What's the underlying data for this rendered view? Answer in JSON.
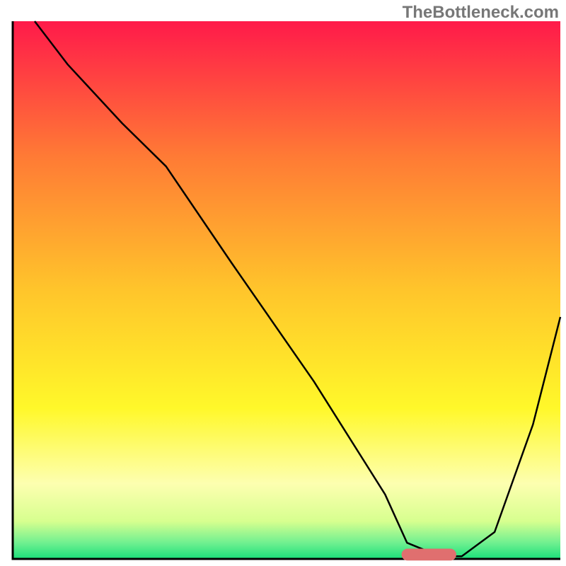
{
  "watermark": "TheBottleneck.com",
  "chart_data": {
    "type": "line",
    "title": "",
    "xlabel": "",
    "ylabel": "",
    "xlim": [
      0,
      100
    ],
    "ylim": [
      0,
      100
    ],
    "background": {
      "type": "vertical-gradient",
      "stops": [
        {
          "pos": 0.0,
          "color": "#ff1a4a"
        },
        {
          "pos": 0.25,
          "color": "#ff7a35"
        },
        {
          "pos": 0.5,
          "color": "#ffc52b"
        },
        {
          "pos": 0.72,
          "color": "#fff82a"
        },
        {
          "pos": 0.86,
          "color": "#fdffb0"
        },
        {
          "pos": 0.93,
          "color": "#d7ff8f"
        },
        {
          "pos": 0.97,
          "color": "#70f090"
        },
        {
          "pos": 1.0,
          "color": "#1adf7a"
        }
      ]
    },
    "series": [
      {
        "name": "bottleneck-curve",
        "color": "#000000",
        "stroke_width": 2.5,
        "x": [
          4,
          10,
          20,
          28,
          40,
          55,
          68,
          72,
          78,
          82,
          88,
          95,
          100
        ],
        "y": [
          100,
          92,
          81,
          73,
          55,
          33,
          12,
          3,
          0.5,
          0.5,
          5,
          25,
          45
        ]
      }
    ],
    "marker": {
      "name": "optimal-zone",
      "shape": "rounded-bar",
      "color": "#e06f6f",
      "x_center": 76,
      "y": 0.8,
      "width": 10,
      "height": 2.2
    },
    "axes": {
      "show_ticks": false,
      "show_grid": false,
      "border_color": "#000000",
      "border_width": 3
    }
  }
}
